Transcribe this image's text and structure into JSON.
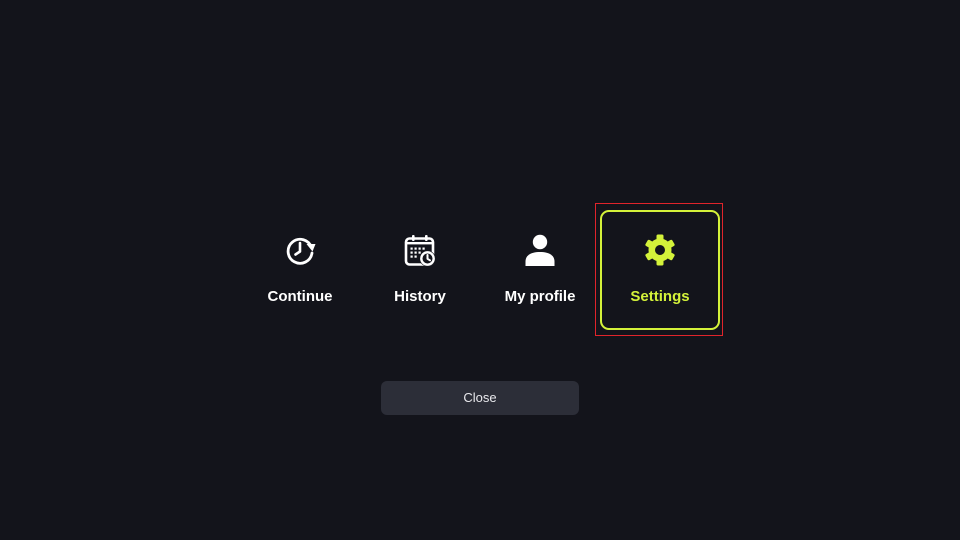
{
  "menu": {
    "items": [
      {
        "label": "Continue",
        "icon": "continue-icon",
        "selected": false
      },
      {
        "label": "History",
        "icon": "calendar-clock-icon",
        "selected": false
      },
      {
        "label": "My profile",
        "icon": "person-icon",
        "selected": false
      },
      {
        "label": "Settings",
        "icon": "gear-icon",
        "selected": true
      }
    ]
  },
  "close_button": {
    "label": "Close"
  },
  "colors": {
    "background": "#13141b",
    "accent": "#d4f23a",
    "text": "#ffffff",
    "button_bg": "#2c2e38",
    "focus_outline": "#e0242b"
  }
}
